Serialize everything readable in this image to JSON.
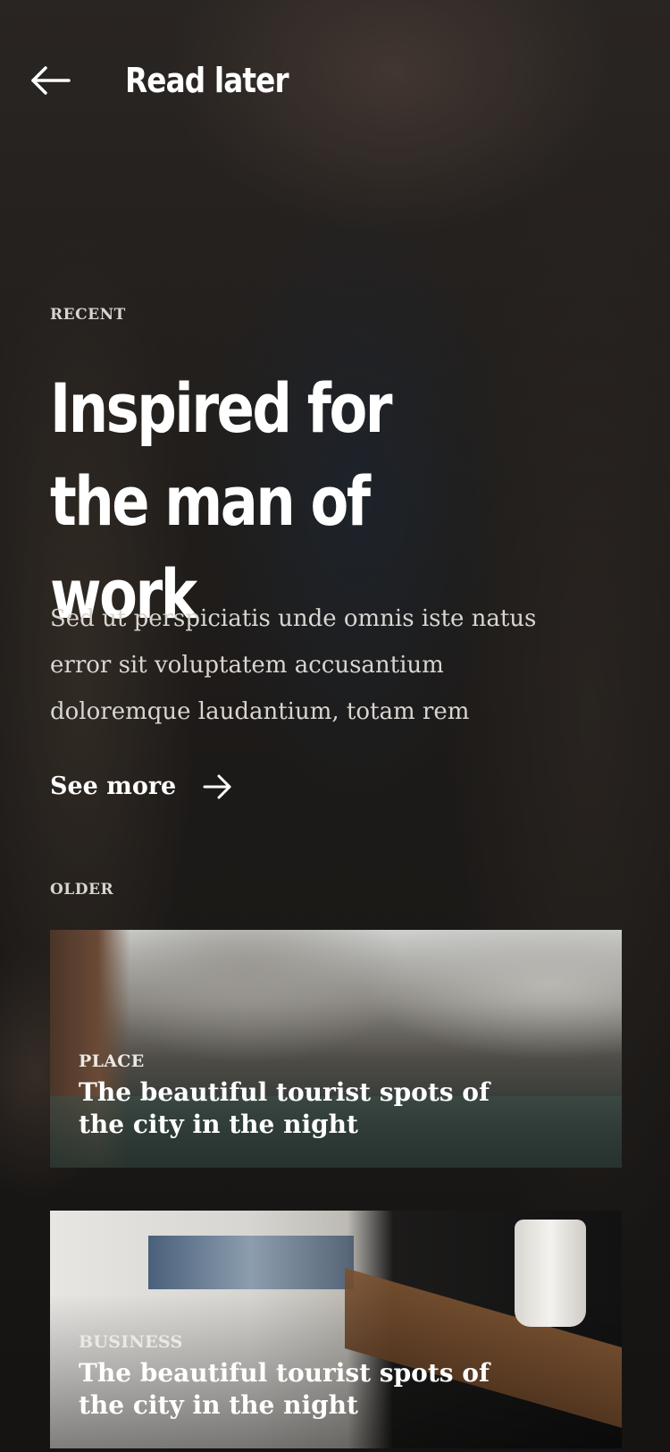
{
  "header": {
    "title": "Read later",
    "back_icon": "arrow-left-icon"
  },
  "recent": {
    "label": "RECENT",
    "title_line1": "Inspired for",
    "title_line2": "the man of work",
    "description": "Sed ut perspiciatis unde omnis iste natus error sit voluptatem accusantium doloremque laudantium, totam rem",
    "see_more_label": "See more",
    "see_more_icon": "arrow-right-icon"
  },
  "older": {
    "label": "OLDER",
    "cards": [
      {
        "category": "PLACE",
        "title": "The beautiful tourist spots of the city in the night"
      },
      {
        "category": "BUSINESS",
        "title": "The beautiful tourist spots of the city in the night"
      }
    ]
  },
  "colors": {
    "text_primary": "#ffffff",
    "text_secondary": "#d9d5d0",
    "background": "#2b2724"
  }
}
